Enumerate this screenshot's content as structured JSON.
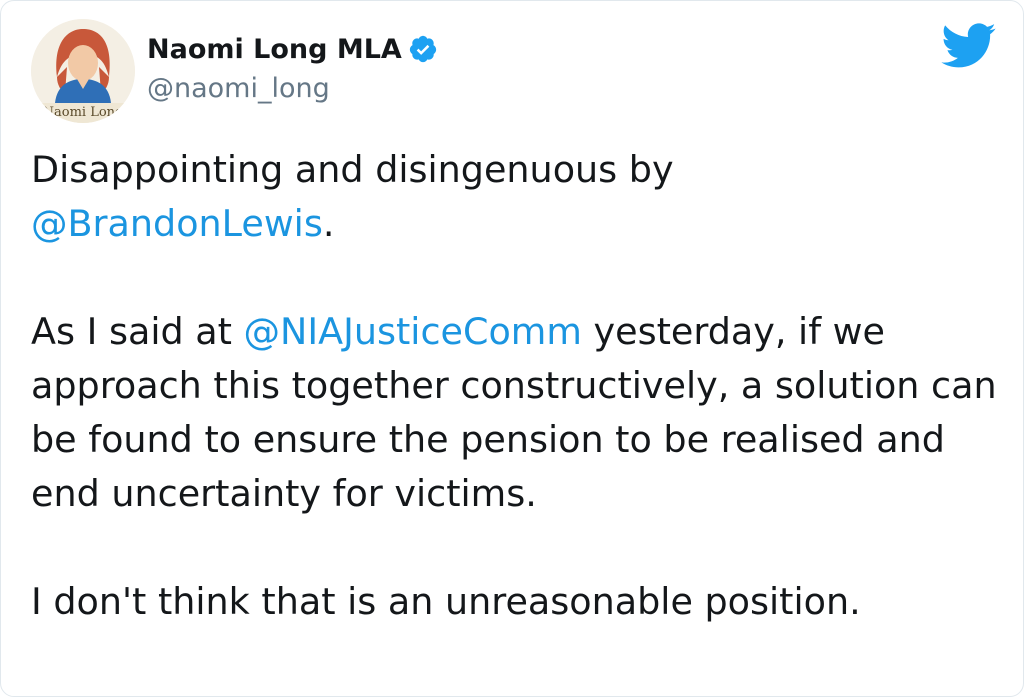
{
  "author": {
    "display_name": "Naomi Long MLA",
    "handle": "@naomi_long",
    "verified": true,
    "avatar_caption": "Naomi Long"
  },
  "brand_icon": "twitter-bird-icon",
  "colors": {
    "link": "#1b95e0",
    "text": "#14171a",
    "secondary": "#657786",
    "twitter_blue": "#1da1f2"
  },
  "tweet": {
    "p1": {
      "text": "Disappointing and disingenuous by",
      "mention": "@BrandonLewis",
      "suffix": "."
    },
    "p2": {
      "prefix": "As I said at",
      "mention": "@NIAJusticeComm",
      "rest": "yesterday, if we approach this together constructively, a solution can be found to ensure the pension to be realised and end uncertainty for victims."
    },
    "p3": {
      "text": "I don't think that is an unreasonable position."
    }
  }
}
